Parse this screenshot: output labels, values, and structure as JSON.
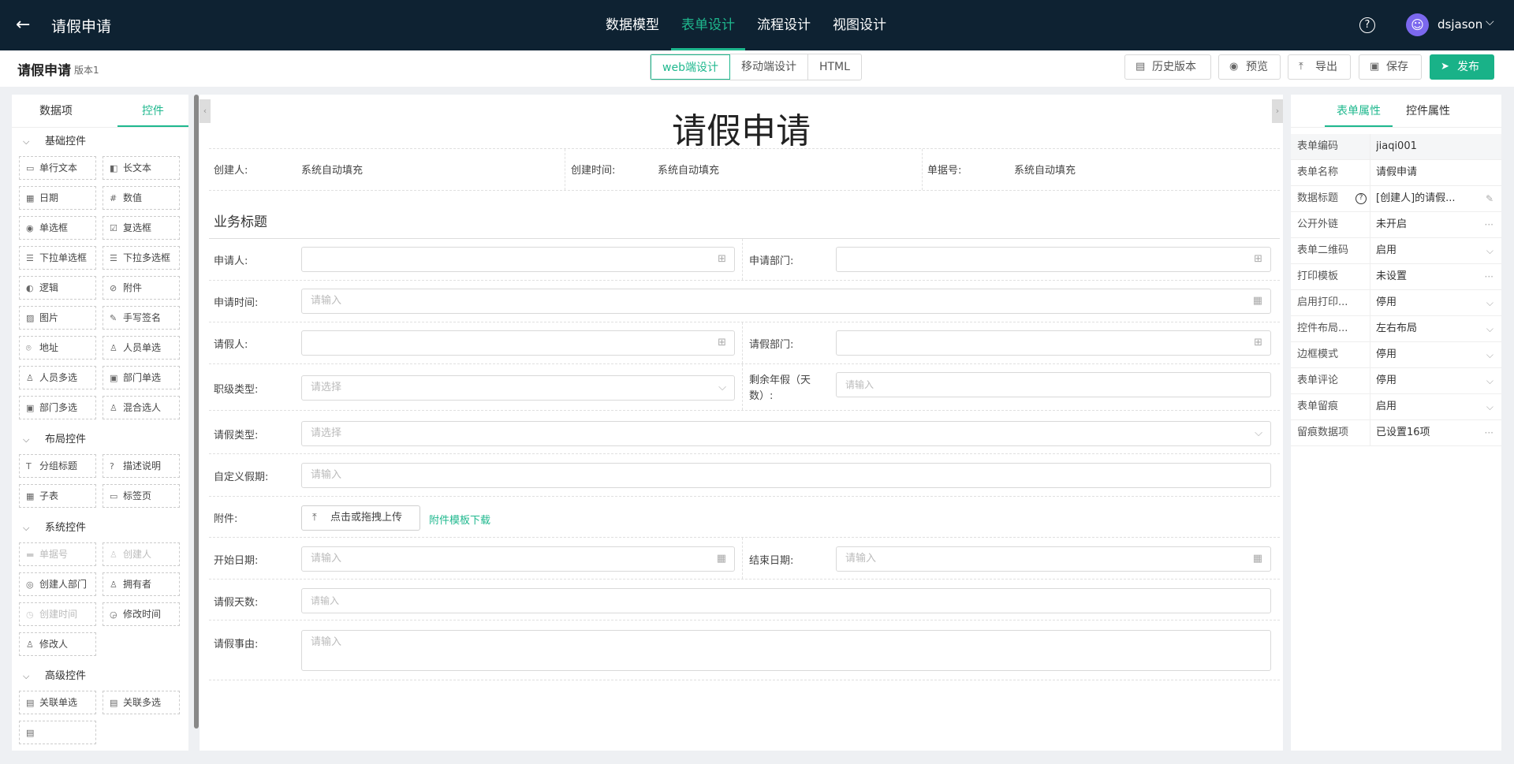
{
  "topbar": {
    "title": "请假申请",
    "tabs": [
      "数据模型",
      "表单设计",
      "流程设计",
      "视图设计"
    ],
    "username": "dsjason"
  },
  "subbar": {
    "form_title": "请假申请",
    "version": "版本1",
    "segments": [
      "web端设计",
      "移动端设计",
      "HTML"
    ],
    "buttons": {
      "history": "历史版本",
      "preview": "预览",
      "export": "导出",
      "save": "保存",
      "publish": "发布"
    }
  },
  "left": {
    "tabs": [
      "数据项",
      "控件"
    ],
    "sections": {
      "basic": "基础控件",
      "layout": "布局控件",
      "system": "系统控件",
      "advanced": "高级控件"
    },
    "basic": [
      "单行文本",
      "长文本",
      "日期",
      "数值",
      "单选框",
      "复选框",
      "下拉单选框",
      "下拉多选框",
      "逻辑",
      "附件",
      "图片",
      "手写签名",
      "地址",
      "人员单选",
      "人员多选",
      "部门单选",
      "部门多选",
      "混合选人"
    ],
    "layout": [
      "分组标题",
      "描述说明",
      "子表",
      "标签页"
    ],
    "system": [
      "单据号",
      "创建人",
      "创建人部门",
      "拥有者",
      "创建时间",
      "修改时间",
      "修改人"
    ],
    "advanced": [
      "关联单选",
      "关联多选"
    ]
  },
  "canvas": {
    "title": "请假申请",
    "meta": {
      "creator_label": "创建人:",
      "creator_value": "系统自动填充",
      "ctime_label": "创建时间:",
      "ctime_value": "系统自动填充",
      "docno_label": "单据号:",
      "docno_value": "系统自动填充"
    },
    "biz_title": "业务标题",
    "fields": {
      "applicant": "申请人:",
      "dept": "申请部门:",
      "apply_time": "申请时间:",
      "leave_person": "请假人:",
      "leave_dept": "请假部门:",
      "rank_type": "职级类型:",
      "remaining": "剩余年假（天数）:",
      "leave_type": "请假类型:",
      "custom_holiday": "自定义假期:",
      "attachment": "附件:",
      "start_date": "开始日期:",
      "end_date": "结束日期:",
      "days": "请假天数:",
      "reason": "请假事由:"
    },
    "placeholders": {
      "input": "请输入",
      "select": "请选择"
    },
    "upload_label": "点击或拖拽上传",
    "template_link": "附件模板下载"
  },
  "right": {
    "tabs": [
      "表单属性",
      "控件属性"
    ],
    "props": [
      {
        "k": "表单编码",
        "v": "jiaqi001",
        "t": ""
      },
      {
        "k": "表单名称",
        "v": "请假申请",
        "t": ""
      },
      {
        "k": "数据标题",
        "v": "[创建人]的请假...",
        "t": "✎"
      },
      {
        "k": "公开外链",
        "v": "未开启",
        "t": "···"
      },
      {
        "k": "表单二维码",
        "v": "启用",
        "t": "⌵"
      },
      {
        "k": "打印模板",
        "v": "未设置",
        "t": "···"
      },
      {
        "k": "启用打印...",
        "v": "停用",
        "t": "⌵"
      },
      {
        "k": "控件布局...",
        "v": "左右布局",
        "t": "⌵"
      },
      {
        "k": "边框模式",
        "v": "停用",
        "t": "⌵"
      },
      {
        "k": "表单评论",
        "v": "停用",
        "t": "⌵"
      },
      {
        "k": "表单留痕",
        "v": "启用",
        "t": "⌵"
      },
      {
        "k": "留痕数据项",
        "v": "已设置16项",
        "t": "···"
      }
    ]
  },
  "colors": {
    "accent": "#1fb88e",
    "topbar": "#0e2232",
    "publish": "#19b288"
  }
}
